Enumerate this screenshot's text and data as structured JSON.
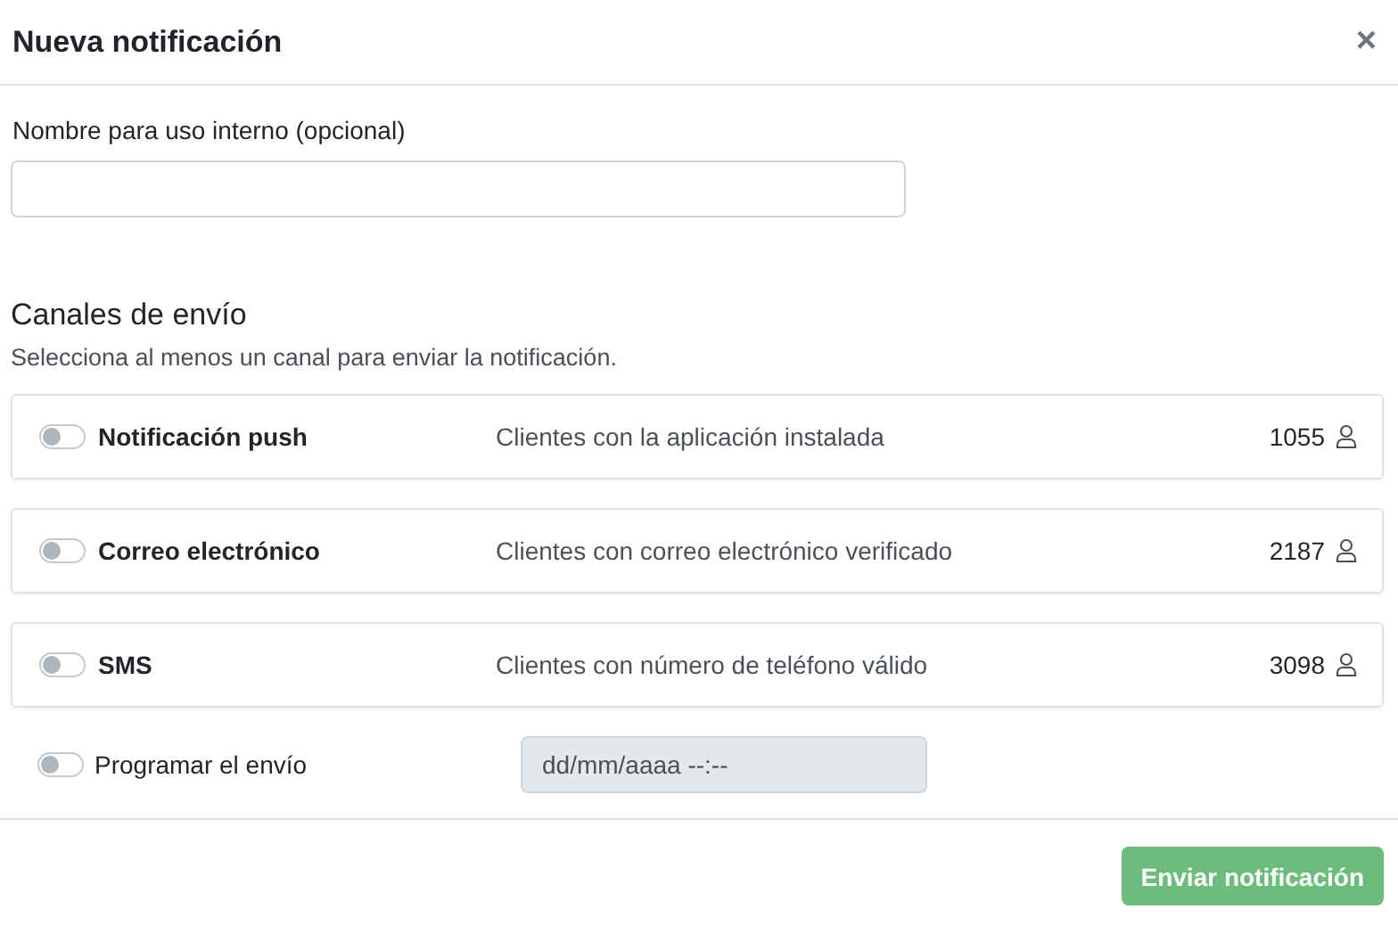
{
  "modal": {
    "title": "Nueva notificación",
    "close": "×"
  },
  "name_field": {
    "label": "Nombre para uso interno (opcional)"
  },
  "channels_section": {
    "title": "Canales de envío",
    "subtitle": "Selecciona al menos un canal para enviar la notificación."
  },
  "channels": [
    {
      "name": "Notificación push",
      "on": false,
      "description": "Clientes con la aplicación instalada",
      "count": "1055"
    },
    {
      "name": "Correo electrónico",
      "on": false,
      "description": "Clientes con correo electrónico verificado",
      "count": "2187"
    },
    {
      "name": "SMS",
      "on": false,
      "description": "Clientes con número de teléfono válido",
      "count": "3098"
    }
  ],
  "schedule": {
    "label": "Programar el envío",
    "on": false,
    "placeholder": "dd/mm/aaaa --:--",
    "disabled": true
  },
  "footer": {
    "submit": {
      "label": "Enviar notificación",
      "disabled": true
    }
  }
}
